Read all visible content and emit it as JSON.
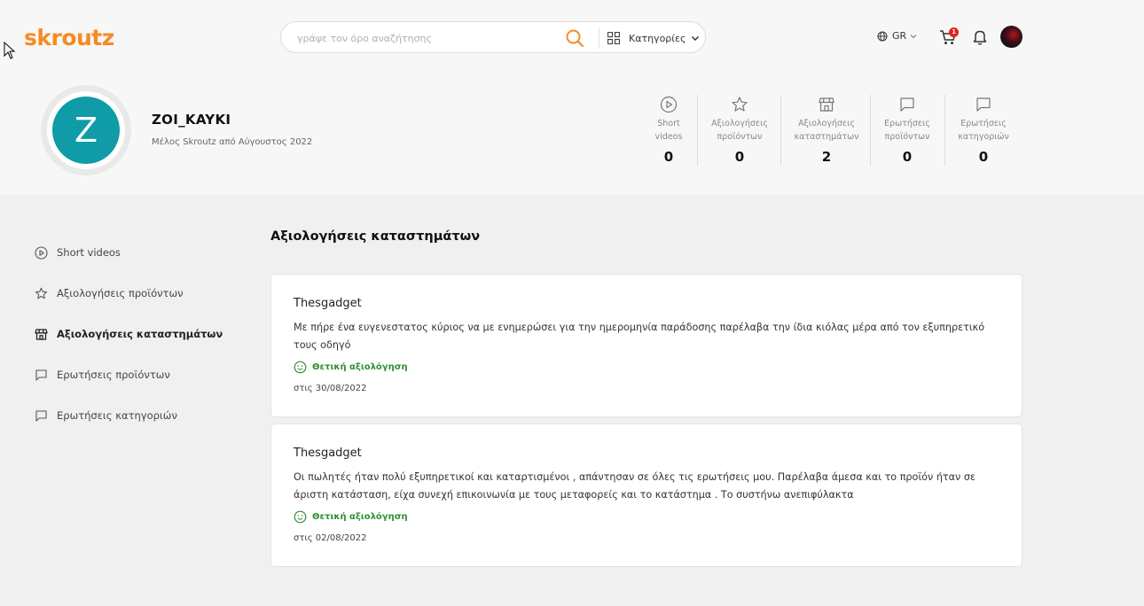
{
  "header": {
    "logo": "skroutz",
    "search": {
      "placeholder": "γράψε τον όρο αναζήτησης",
      "categories_label": "Κατηγορίες"
    },
    "language": "GR",
    "cart_count": "1"
  },
  "profile": {
    "avatar_letter": "Z",
    "username": "ZOI_KAYKI",
    "member_since": "Μέλος Skroutz από Αύγουστος 2022"
  },
  "stats": [
    {
      "icon": "play-circle-icon",
      "label_line1": "Short",
      "label_line2": "videos",
      "value": "0"
    },
    {
      "icon": "star-icon",
      "label_line1": "Αξιολογήσεις",
      "label_line2": "προϊόντων",
      "value": "0"
    },
    {
      "icon": "store-icon",
      "label_line1": "Αξιολογήσεις",
      "label_line2": "καταστημάτων",
      "value": "2"
    },
    {
      "icon": "chat-icon",
      "label_line1": "Ερωτήσεις",
      "label_line2": "προϊόντων",
      "value": "0"
    },
    {
      "icon": "chat-icon",
      "label_line1": "Ερωτήσεις",
      "label_line2": "κατηγοριών",
      "value": "0"
    }
  ],
  "sidebar": {
    "items": [
      {
        "icon": "play-circle-icon",
        "label": "Short videos",
        "active": false
      },
      {
        "icon": "star-icon",
        "label": "Αξιολογήσεις προϊόντων",
        "active": false
      },
      {
        "icon": "store-icon",
        "label": "Αξιολογήσεις καταστημάτων",
        "active": true
      },
      {
        "icon": "chat-icon",
        "label": "Ερωτήσεις προϊόντων",
        "active": false
      },
      {
        "icon": "chat-icon",
        "label": "Ερωτήσεις κατηγοριών",
        "active": false
      }
    ]
  },
  "main": {
    "title": "Αξιολογήσεις καταστημάτων",
    "reviews": [
      {
        "shop": "Thesgadget",
        "text": "Με πήρε ένα ευγενεστατος κύριος να με ενημερώσει για την ημερομηνία παράδοσης παρέλαβα την ίδια κιόλας μέρα από τον εξυπηρετικό τους οδηγό",
        "verdict": "Θετική αξιολόγηση",
        "date": "στις 30/08/2022"
      },
      {
        "shop": "Thesgadget",
        "text": "Οι πωλητές ήταν πολύ εξυπηρετικοί και καταρτισμένοι , απάντησαν σε όλες τις ερωτήσεις μου. Παρέλαβα άμεσα και το προϊόν ήταν σε άριστη κατάσταση, είχα συνεχή επικοινωνία με τους μεταφορείς και το κατάστημα . Το συστήνω ανεπιφύλακτα",
        "verdict": "Θετική αξιολόγηση",
        "date": "στις 02/08/2022"
      }
    ]
  },
  "colors": {
    "brand": "#f68b24",
    "avatar_bg": "#0f9ba8",
    "positive": "#2f8f34",
    "badge": "#e2231a"
  }
}
